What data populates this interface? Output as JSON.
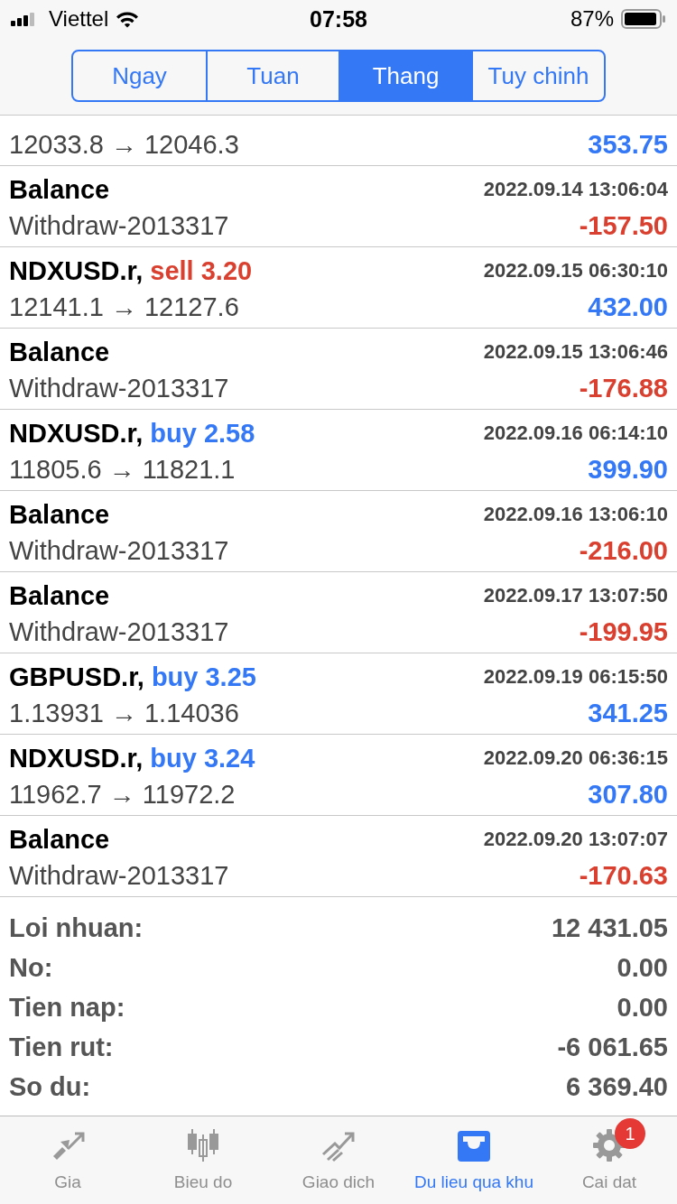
{
  "status_bar": {
    "carrier": "Viettel",
    "time": "07:58",
    "battery": "87%"
  },
  "period_tabs": [
    {
      "label": "Ngay",
      "selected": false
    },
    {
      "label": "Tuan",
      "selected": false
    },
    {
      "label": "Thang",
      "selected": true
    },
    {
      "label": "Tuy chinh",
      "selected": false
    }
  ],
  "history": [
    {
      "kind": "partial",
      "detail": "12033.8 → 12046.3",
      "amount": "353.75",
      "color": "#3478f6"
    },
    {
      "kind": "balance",
      "title": "Balance",
      "time": "2022.09.14 13:06:04",
      "detail": "Withdraw-2013317",
      "amount": "-157.50",
      "color": "#d9402f"
    },
    {
      "kind": "trade",
      "title": "NDXUSD.r,",
      "side": "sell",
      "volume": "3.20",
      "time": "2022.09.15 06:30:10",
      "detail": "12141.1 → 12127.6",
      "amount": "432.00",
      "color": "#3478f6"
    },
    {
      "kind": "balance",
      "title": "Balance",
      "time": "2022.09.15 13:06:46",
      "detail": "Withdraw-2013317",
      "amount": "-176.88",
      "color": "#d9402f"
    },
    {
      "kind": "trade",
      "title": "NDXUSD.r,",
      "side": "buy",
      "volume": "2.58",
      "time": "2022.09.16 06:14:10",
      "detail": "11805.6 → 11821.1",
      "amount": "399.90",
      "color": "#3478f6"
    },
    {
      "kind": "balance",
      "title": "Balance",
      "time": "2022.09.16 13:06:10",
      "detail": "Withdraw-2013317",
      "amount": "-216.00",
      "color": "#d9402f"
    },
    {
      "kind": "balance",
      "title": "Balance",
      "time": "2022.09.17 13:07:50",
      "detail": "Withdraw-2013317",
      "amount": "-199.95",
      "color": "#d9402f"
    },
    {
      "kind": "trade",
      "title": "GBPUSD.r,",
      "side": "buy",
      "volume": "3.25",
      "time": "2022.09.19 06:15:50",
      "detail": "1.13931 → 1.14036",
      "amount": "341.25",
      "color": "#3478f6"
    },
    {
      "kind": "trade",
      "title": "NDXUSD.r,",
      "side": "buy",
      "volume": "3.24",
      "time": "2022.09.20 06:36:15",
      "detail": "11962.7 → 11972.2",
      "amount": "307.80",
      "color": "#3478f6"
    },
    {
      "kind": "balance",
      "title": "Balance",
      "time": "2022.09.20 13:07:07",
      "detail": "Withdraw-2013317",
      "amount": "-170.63",
      "color": "#d9402f"
    }
  ],
  "summary": [
    {
      "label": "Loi nhuan:",
      "value": "12 431.05"
    },
    {
      "label": "No:",
      "value": "0.00"
    },
    {
      "label": "Tien nap:",
      "value": "0.00"
    },
    {
      "label": "Tien rut:",
      "value": "-6 061.65"
    },
    {
      "label": "So du:",
      "value": "6 369.40"
    }
  ],
  "tab_bar": [
    {
      "kind": "quotes",
      "label": "Gia",
      "selected": false
    },
    {
      "kind": "chart",
      "label": "Bieu do",
      "selected": false
    },
    {
      "kind": "trade",
      "label": "Giao dich",
      "selected": false
    },
    {
      "kind": "history",
      "label": "Du lieu qua khu",
      "selected": true
    },
    {
      "kind": "settings",
      "label": "Cai dat",
      "selected": false,
      "badge": "1"
    }
  ]
}
